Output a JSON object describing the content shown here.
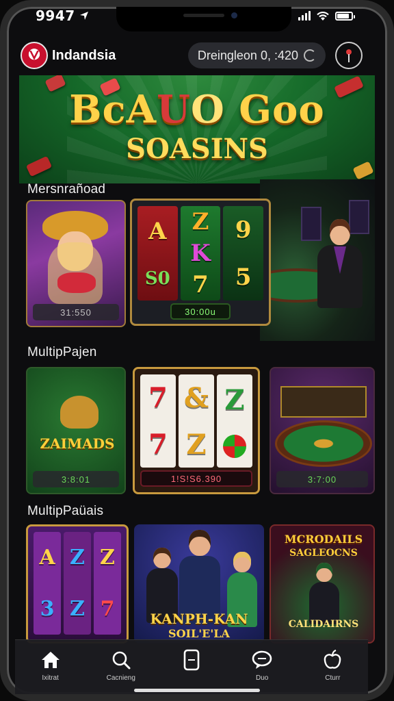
{
  "status_bar": {
    "time": "9947"
  },
  "header": {
    "brand": "Indandsia",
    "balance_label": "Dreingleon 0, :420"
  },
  "hero": {
    "title_part1": "BcA",
    "title_part2": "U",
    "title_part3": "O",
    "title_part4": " Goo",
    "subtitle": "SOASINS"
  },
  "sections": [
    {
      "title": "Mersnrañoad",
      "tiles": [
        {
          "label": "31:550"
        },
        {
          "label": "30:00u",
          "reels": [
            [
              "A",
              "S0"
            ],
            [
              "Z",
              "K",
              "7"
            ],
            [
              "9",
              "5"
            ]
          ]
        }
      ]
    },
    {
      "title": "MultipPajen",
      "tiles": [
        {
          "label": "3:8:01",
          "art_text": "ZAIMADS"
        },
        {
          "label": "1!S!S6.390",
          "reels": [
            [
              "7",
              "7"
            ],
            [
              "&",
              "Z"
            ],
            [
              "Z"
            ]
          ]
        },
        {
          "label": "3:7:00"
        }
      ]
    },
    {
      "title": "MultipPaüais",
      "tiles": [
        {
          "reels": [
            [
              "A",
              "3"
            ],
            [
              "Z",
              "Z"
            ],
            [
              "Z",
              "7"
            ]
          ]
        },
        {
          "art_text": "KANPH-KAN",
          "art_sub": "SOIL'E'LA"
        },
        {
          "art_text": "MCRODAILS",
          "art_sub": "SAGLEOCNS",
          "art_bottom": "CALIDAIRNS"
        }
      ]
    }
  ],
  "bottom_nav": [
    {
      "label": "Ixitrat",
      "icon": "home-icon"
    },
    {
      "label": "Cacnieng",
      "icon": "search-icon"
    },
    {
      "label": "",
      "icon": "card-icon"
    },
    {
      "label": "Duo",
      "icon": "chat-icon"
    },
    {
      "label": "Cturr",
      "icon": "apple-icon"
    }
  ]
}
